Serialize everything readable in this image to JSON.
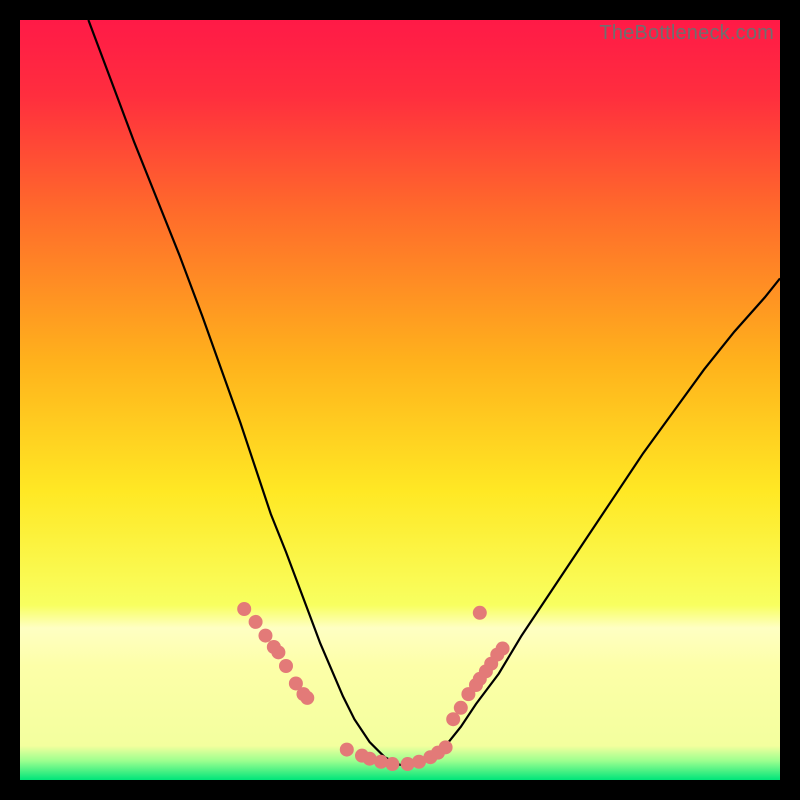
{
  "watermark": "TheBottleneck.com",
  "chart_data": {
    "type": "line",
    "title": "",
    "xlabel": "",
    "ylabel": "",
    "xlim": [
      0,
      100
    ],
    "ylim": [
      0,
      100
    ],
    "background_gradient": {
      "stops": [
        {
          "offset": 0.0,
          "color": "#ff1a47"
        },
        {
          "offset": 0.1,
          "color": "#ff2e3e"
        },
        {
          "offset": 0.25,
          "color": "#ff6a2b"
        },
        {
          "offset": 0.45,
          "color": "#ffb21c"
        },
        {
          "offset": 0.62,
          "color": "#ffe824"
        },
        {
          "offset": 0.77,
          "color": "#f8ff60"
        },
        {
          "offset": 0.8,
          "color": "#feffc3"
        },
        {
          "offset": 0.85,
          "color": "#fdffa8"
        },
        {
          "offset": 0.955,
          "color": "#f3ff9e"
        },
        {
          "offset": 0.975,
          "color": "#9bff8f"
        },
        {
          "offset": 1.0,
          "color": "#00e57a"
        }
      ]
    },
    "series": [
      {
        "name": "bottleneck-curve",
        "style": "black-line",
        "x": [
          9.0,
          12,
          15,
          18,
          21,
          24,
          26.5,
          29,
          31,
          33,
          35,
          36.5,
          38,
          39.5,
          41,
          42.5,
          44,
          46,
          48,
          50,
          52,
          54,
          56,
          58,
          60,
          63,
          66,
          70,
          74,
          78,
          82,
          86,
          90,
          94,
          98,
          100
        ],
        "y": [
          100,
          92,
          84,
          76.5,
          69,
          61,
          54,
          47,
          41,
          35,
          30,
          26,
          22,
          18,
          14.5,
          11,
          8,
          5,
          3,
          2,
          2,
          3,
          4.5,
          7,
          10,
          14,
          19,
          25,
          31,
          37,
          43,
          48.5,
          54,
          59,
          63.5,
          66
        ]
      },
      {
        "name": "markers-left-cluster",
        "style": "salmon-dot",
        "x": [
          29.5,
          31.0,
          32.3,
          33.4,
          34.0,
          35.0,
          36.3,
          37.3,
          37.8
        ],
        "y": [
          22.5,
          20.8,
          19.0,
          17.5,
          16.8,
          15.0,
          12.7,
          11.3,
          10.8
        ]
      },
      {
        "name": "markers-valley-cluster",
        "style": "salmon-dot",
        "x": [
          43.0,
          45.0,
          46.0,
          47.5,
          49.0,
          51.0,
          52.5,
          54.0,
          55.0,
          56.0
        ],
        "y": [
          4.0,
          3.2,
          2.8,
          2.4,
          2.1,
          2.1,
          2.4,
          3.0,
          3.6,
          4.3
        ]
      },
      {
        "name": "markers-right-cluster",
        "style": "salmon-dot",
        "x": [
          57.0,
          58.0,
          59.0,
          60.0,
          60.5,
          61.3,
          62.0,
          62.8,
          63.5,
          60.5
        ],
        "y": [
          8.0,
          9.5,
          11.3,
          12.5,
          13.3,
          14.3,
          15.3,
          16.5,
          17.3,
          22.0
        ]
      }
    ],
    "styles": {
      "black-line": {
        "stroke": "#000000",
        "stroke_width": 2.2,
        "fill": "none"
      },
      "salmon-dot": {
        "fill": "#e37a78",
        "radius": 7
      }
    }
  }
}
